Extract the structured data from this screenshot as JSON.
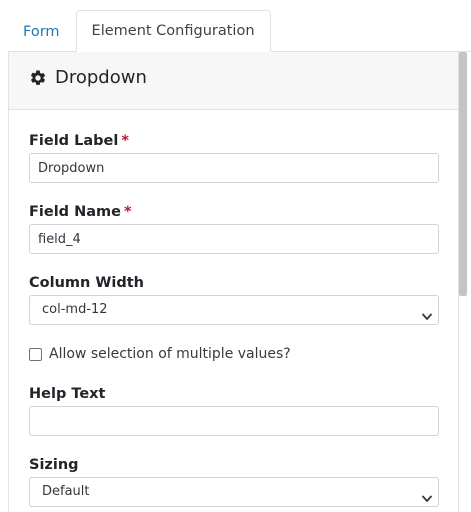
{
  "tabs": {
    "form_label": "Form",
    "config_label": "Element Configuration"
  },
  "panel": {
    "title": "Dropdown",
    "icon": "gear-icon"
  },
  "fields": {
    "field_label": {
      "label": "Field Label",
      "required_mark": "*",
      "value": "Dropdown"
    },
    "field_name": {
      "label": "Field Name",
      "required_mark": "*",
      "value": "field_4"
    },
    "column_width": {
      "label": "Column Width",
      "selected": "col-md-12"
    },
    "multiple": {
      "label": "Allow selection of multiple values?",
      "checked": false
    },
    "help_text": {
      "label": "Help Text",
      "value": ""
    },
    "sizing": {
      "label": "Sizing",
      "selected": "Default"
    }
  },
  "colors": {
    "link": "#1f7ab8",
    "required": "#c0142a",
    "header_bg": "#f7f7f8",
    "border": "#ced4da"
  }
}
